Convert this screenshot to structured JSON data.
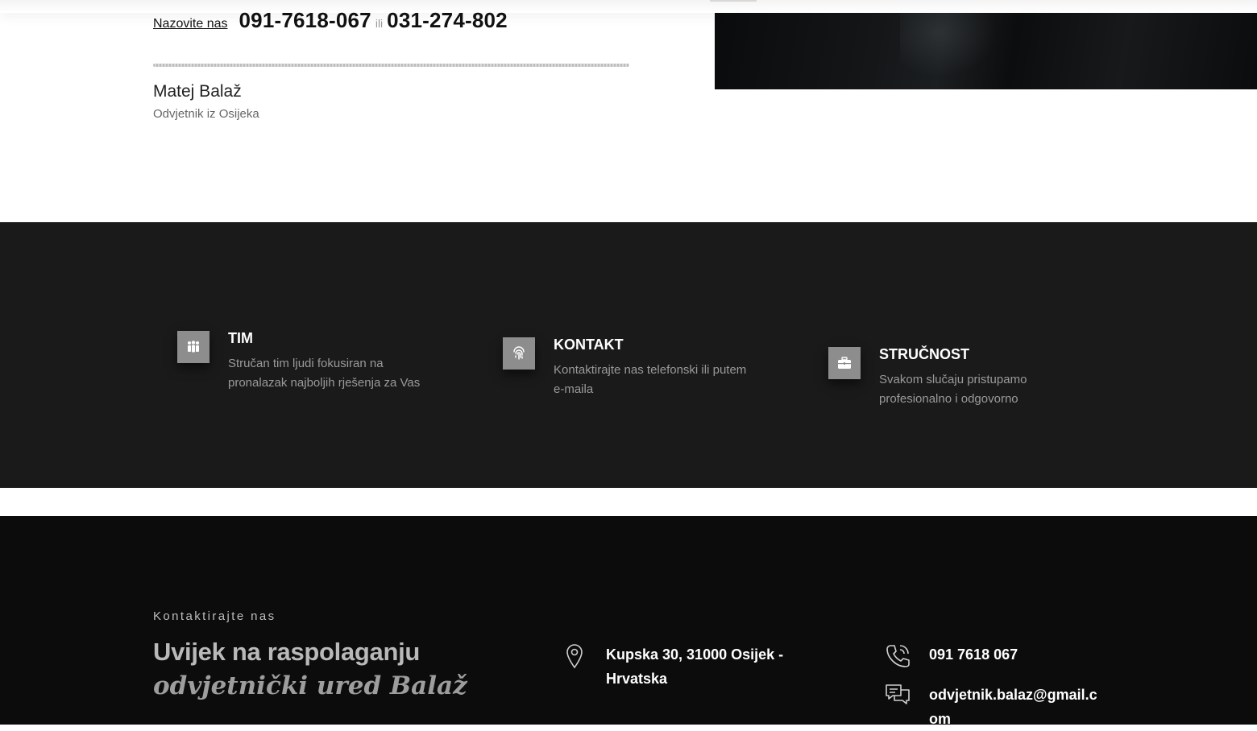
{
  "hero": {
    "call_label": "Nazovite nas",
    "phone_primary": "091-7618-067",
    "separator": "ili",
    "phone_secondary": "031-274-802",
    "author_name": "Matej Balaž",
    "author_role": "Odvjetnik iz Osijeka"
  },
  "features": [
    {
      "icon": "team-icon",
      "title": "TIM",
      "description": "Stručan tim ljudi fokusiran na pronalazak najboljih rješenja za Vas"
    },
    {
      "icon": "fingerprint-icon",
      "title": "KONTAKT",
      "description": "Kontaktirajte nas telefonski ili putem e-maila"
    },
    {
      "icon": "briefcase-icon",
      "title": "STRUČNOST",
      "description": "Svakom slučaju pristupamo profesionalno i odgovorno"
    }
  ],
  "footer": {
    "kicker": "Kontaktirajte nas",
    "headline": "Uvijek na raspolaganju",
    "tagline": "odvjetnički ured Balaž",
    "address": {
      "icon": "map-pin-icon",
      "text": "Kupska 30, 31000 Osijek - Hrvatska"
    },
    "phone": {
      "icon": "phone-icon",
      "text": "091 7618 067"
    },
    "email": {
      "icon": "chat-icon",
      "text": "odvjetnik.balaz@gmail.com"
    }
  },
  "colors": {
    "features_bg": "#1a1a1b",
    "footer_bg": "#0c0c0c",
    "icon_box": "#8d8d8d"
  }
}
